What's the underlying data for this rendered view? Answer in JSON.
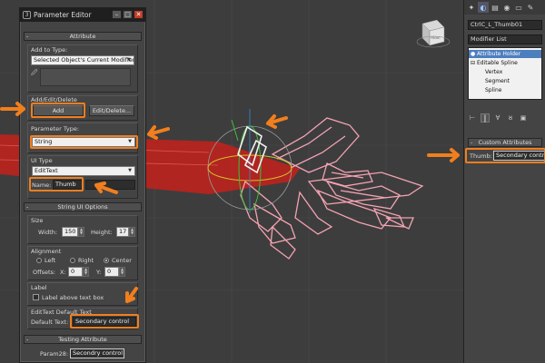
{
  "editor": {
    "title": "Parameter Editor",
    "attribute_header": "Attribute",
    "add_to_type_label": "Add to Type:",
    "add_to_type_value": "Selected Object's Current Modifier",
    "add_edit_delete_label": "Add/Edit/Delete",
    "add_button": "Add",
    "edit_delete_button": "Edit/Delete...",
    "parameter_type_label": "Parameter Type:",
    "parameter_type_value": "String",
    "ui_type_label": "UI Type",
    "ui_type_value": "EditText",
    "name_label": "Name:",
    "name_value": "Thumb",
    "string_ui_header": "String UI Options",
    "size_label": "Size",
    "width_label": "Width:",
    "width_value": "150",
    "height_label": "Height:",
    "height_value": "17",
    "alignment_label": "Alignment",
    "align_left": "Left",
    "align_right": "Right",
    "align_center": "Center",
    "offsets_label": "Offsets:",
    "offset_x_label": "X:",
    "offset_x_value": "0",
    "offset_y_label": "Y:",
    "offset_y_value": "0",
    "label_group": "Label",
    "label_above_text": "Label above text box",
    "edittext_default_label": "EditText Default Text",
    "default_text_label": "Default Text:",
    "default_text_value": "Secondary control",
    "testing_header": "Testing Attribute",
    "param_label": "Param28:",
    "param_value": "Secondry control"
  },
  "command_panel": {
    "object_name": "CtrlC_L_Thumb01",
    "modifier_list": "Modifier List",
    "stack_items": [
      "Attribute Holder",
      "Editable Spline",
      "Vertex",
      "Segment",
      "Spline"
    ],
    "custom_attributes_header": "Custom Attributes",
    "thumb_label": "Thumb:",
    "thumb_value": "Secondary control"
  },
  "viewcube": {
    "face_label": "FRONT"
  },
  "colors": {
    "highlight": "#f07f1e",
    "wire_pink": "#f4a3b2",
    "selection_red": "#c0221c"
  }
}
